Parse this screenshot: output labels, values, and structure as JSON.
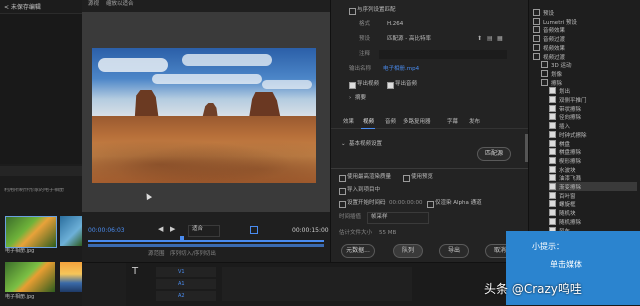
{
  "left_panel": {
    "top_tab": "< 未保存编辑",
    "project_hint": "利用所制作形象的电子相册",
    "bins": [
      {
        "name": "电子相册.jpg",
        "thumb": "butterfly"
      },
      {
        "name": "电子相册.jpg",
        "thumb": "butterfly2"
      },
      {
        "name": "电子相册.jpg",
        "thumb": "butterfly3"
      },
      {
        "name": "电子相册.jpg",
        "thumb": "sunset"
      }
    ]
  },
  "source_panel": {
    "label": "源视",
    "dropdown": "缩放以适合",
    "timecode_left": "00:00:06:03",
    "fit_dropdown": "适合",
    "timecode_right": "00:00:15:00",
    "source_range_label": "源范围",
    "source_range_value": "序列切入/序列切出"
  },
  "export_settings": {
    "match_sequence": "与序列设置匹配",
    "format_label": "格式",
    "format_value": "H.264",
    "preset_label": "预设",
    "preset_value": "匹配源 - 高比特率",
    "comment_label": "注释",
    "output_name_label": "输出名称",
    "output_name_value": "电子相册.mp4",
    "export_video": "导出视频",
    "export_audio": "导出音频",
    "summary": "摘要",
    "tabs": [
      "效果",
      "视频",
      "音频",
      "多路复用器",
      "字幕",
      "发布"
    ],
    "active_tab": "视频",
    "basic_video_settings": "基本视频设置",
    "match_source_btn": "匹配源",
    "max_render_quality": "使用最高渲染质量",
    "use_previews": "使用预览",
    "import_project": "导入到项目中",
    "set_start_timecode": "设置开始时间码",
    "timecode_value": "00:00:00:00",
    "render_alpha": "仅渲染 Alpha 通道",
    "time_interpolation_label": "时间插值",
    "time_interpolation_value": "帧采样",
    "estimated_size_label": "估计文件大小",
    "estimated_size_value": "55 MB",
    "metadata_btn": "元数据...",
    "queue_btn": "队列",
    "export_btn": "导出",
    "cancel_btn": "取消"
  },
  "effects_tree": {
    "items": [
      {
        "label": "预设",
        "checked": false,
        "indent": 0
      },
      {
        "label": "Lumetri 预设",
        "checked": false,
        "indent": 0
      },
      {
        "label": "音频效果",
        "checked": false,
        "indent": 0
      },
      {
        "label": "音频过渡",
        "checked": false,
        "indent": 0
      },
      {
        "label": "视频效果",
        "checked": false,
        "indent": 0
      },
      {
        "label": "视频过渡",
        "checked": false,
        "indent": 0
      },
      {
        "label": "3D 运动",
        "checked": false,
        "indent": 1
      },
      {
        "label": "划像",
        "checked": false,
        "indent": 1
      },
      {
        "label": "擦除",
        "checked": false,
        "indent": 1
      },
      {
        "label": "划出",
        "checked": true,
        "indent": 2
      },
      {
        "label": "双侧平推门",
        "checked": true,
        "indent": 2
      },
      {
        "label": "带状擦除",
        "checked": true,
        "indent": 2
      },
      {
        "label": "径向擦除",
        "checked": true,
        "indent": 2
      },
      {
        "label": "插入",
        "checked": true,
        "indent": 2
      },
      {
        "label": "时钟式擦除",
        "checked": true,
        "indent": 2
      },
      {
        "label": "棋盘",
        "checked": true,
        "indent": 2
      },
      {
        "label": "棋盘擦除",
        "checked": true,
        "indent": 2
      },
      {
        "label": "楔形擦除",
        "checked": true,
        "indent": 2
      },
      {
        "label": "水波块",
        "checked": true,
        "indent": 2
      },
      {
        "label": "油漆飞溅",
        "checked": true,
        "indent": 2
      },
      {
        "label": "渐变擦除",
        "checked": true,
        "indent": 2
      },
      {
        "label": "百叶窗",
        "checked": true,
        "indent": 2
      },
      {
        "label": "螺旋框",
        "checked": true,
        "indent": 2
      },
      {
        "label": "随机块",
        "checked": true,
        "indent": 2
      },
      {
        "label": "随机擦除",
        "checked": true,
        "indent": 2
      },
      {
        "label": "风车",
        "checked": true,
        "indent": 2
      }
    ],
    "selected_index": 20
  },
  "tip": {
    "title": "小提示：",
    "body": "单击媒体"
  },
  "watermark": "头条 @Crazy呜哇",
  "timeline": {
    "track_v1": "V1",
    "track_a1": "A1",
    "track_a2": "A2",
    "timecode_small": "00:00"
  }
}
